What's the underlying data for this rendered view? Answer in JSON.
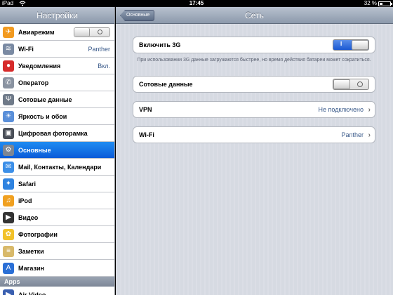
{
  "status": {
    "device": "iPad",
    "time": "17:45",
    "battery": "32 %",
    "battery_level": 0.32
  },
  "sidebar": {
    "title": "Настройки",
    "items": [
      {
        "label": "Авиарежим",
        "icon": "airplane-icon",
        "color": "#f29a1f",
        "glyph": "✈"
      },
      {
        "label": "Wi-Fi",
        "value": "Panther",
        "icon": "wifi-icon",
        "color": "#7a8aa3",
        "glyph": "≋"
      },
      {
        "label": "Уведомления",
        "value": "Вкл.",
        "icon": "notifications-icon",
        "color": "#d62b2b",
        "glyph": "●"
      },
      {
        "label": "Оператор",
        "icon": "phone-icon",
        "color": "#8a93a1",
        "glyph": "✆"
      },
      {
        "label": "Сотовые данные",
        "icon": "antenna-icon",
        "color": "#6f7a89",
        "glyph": "Ψ"
      },
      {
        "label": "Яркость и обои",
        "icon": "brightness-icon",
        "color": "#5a8fd9",
        "glyph": "☀"
      },
      {
        "label": "Цифровая фоторамка",
        "icon": "photoframe-icon",
        "color": "#4a4f58",
        "glyph": "▣"
      },
      {
        "label": "Основные",
        "icon": "gear-icon",
        "color": "#7d8693",
        "glyph": "⚙"
      },
      {
        "label": "Mail, Контакты, Календари",
        "icon": "mail-icon",
        "color": "#3c8fe8",
        "glyph": "✉"
      },
      {
        "label": "Safari",
        "icon": "safari-icon",
        "color": "#2f83e0",
        "glyph": "✦"
      },
      {
        "label": "iPod",
        "icon": "ipod-icon",
        "color": "#f0a020",
        "glyph": "♫"
      },
      {
        "label": "Видео",
        "icon": "video-icon",
        "color": "#333333",
        "glyph": "▶"
      },
      {
        "label": "Фотографии",
        "icon": "photos-icon",
        "color": "#f2c22a",
        "glyph": "✿"
      },
      {
        "label": "Заметки",
        "icon": "notes-icon",
        "color": "#d8b96a",
        "glyph": "≡"
      },
      {
        "label": "Магазин",
        "icon": "store-icon",
        "color": "#2a6fd6",
        "glyph": "A"
      }
    ],
    "section_apps": "Apps",
    "app_items": [
      {
        "label": "Air Video",
        "icon": "airvideo-icon",
        "color": "#3a5fb0",
        "glyph": "▶"
      }
    ],
    "selected_index": 7
  },
  "main": {
    "back_label": "Основные",
    "title": "Сеть",
    "enable_3g": {
      "label": "Включить 3G",
      "state": "on",
      "on_mark": "I"
    },
    "footnote": "При использовании 3G данные загружаются быстрее, но время действия батареи может сократиться.",
    "cellular": {
      "label": "Сотовые данные",
      "state": "off"
    },
    "vpn": {
      "label": "VPN",
      "value": "Не подключено"
    },
    "wifi": {
      "label": "Wi-Fi",
      "value": "Panther"
    }
  }
}
